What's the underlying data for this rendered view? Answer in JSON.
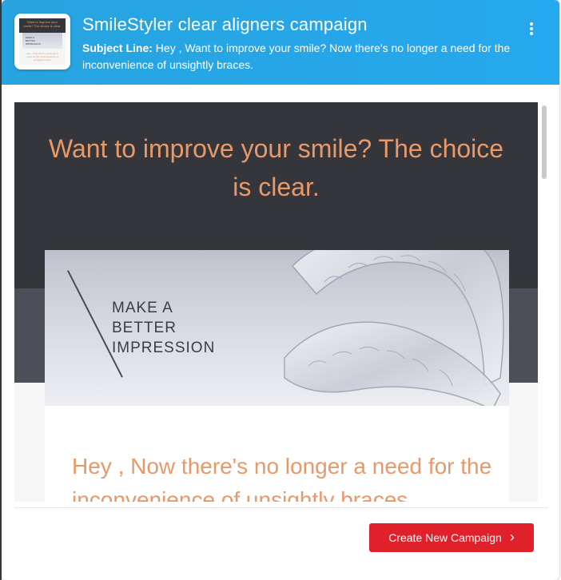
{
  "campaign": {
    "title": "SmileStyler clear aligners campaign",
    "subject_label": "Subject Line:",
    "subject_text": "Hey , Want to improve your smile? Now there's no longer a need for the inconvenience of unsightly braces."
  },
  "thumbnail": {
    "headline": "Want to improve your smile? The choice is clear.",
    "banner_text": "MAKE A\nBETTER\nIMPRESSION",
    "body": "Hey , Now there's no longer a need for the inconvenience of unsightly braces."
  },
  "email_preview": {
    "headline": "Want to improve your smile? The choice is clear.",
    "banner_lines": [
      "MAKE A",
      "BETTER",
      "IMPRESSION"
    ],
    "body": "Hey , Now there's no longer a need for the inconvenience of unsightly braces."
  },
  "actions": {
    "create_label": "Create New Campaign",
    "create_chevron": "›"
  },
  "icons": {
    "menu": "kebab-menu-icon",
    "chevron": "chevron-right-icon"
  },
  "colors": {
    "header": "#27a4df",
    "email_dark": "#34363c",
    "accent_orange": "#e8996a",
    "cta_red": "#e0202b"
  }
}
